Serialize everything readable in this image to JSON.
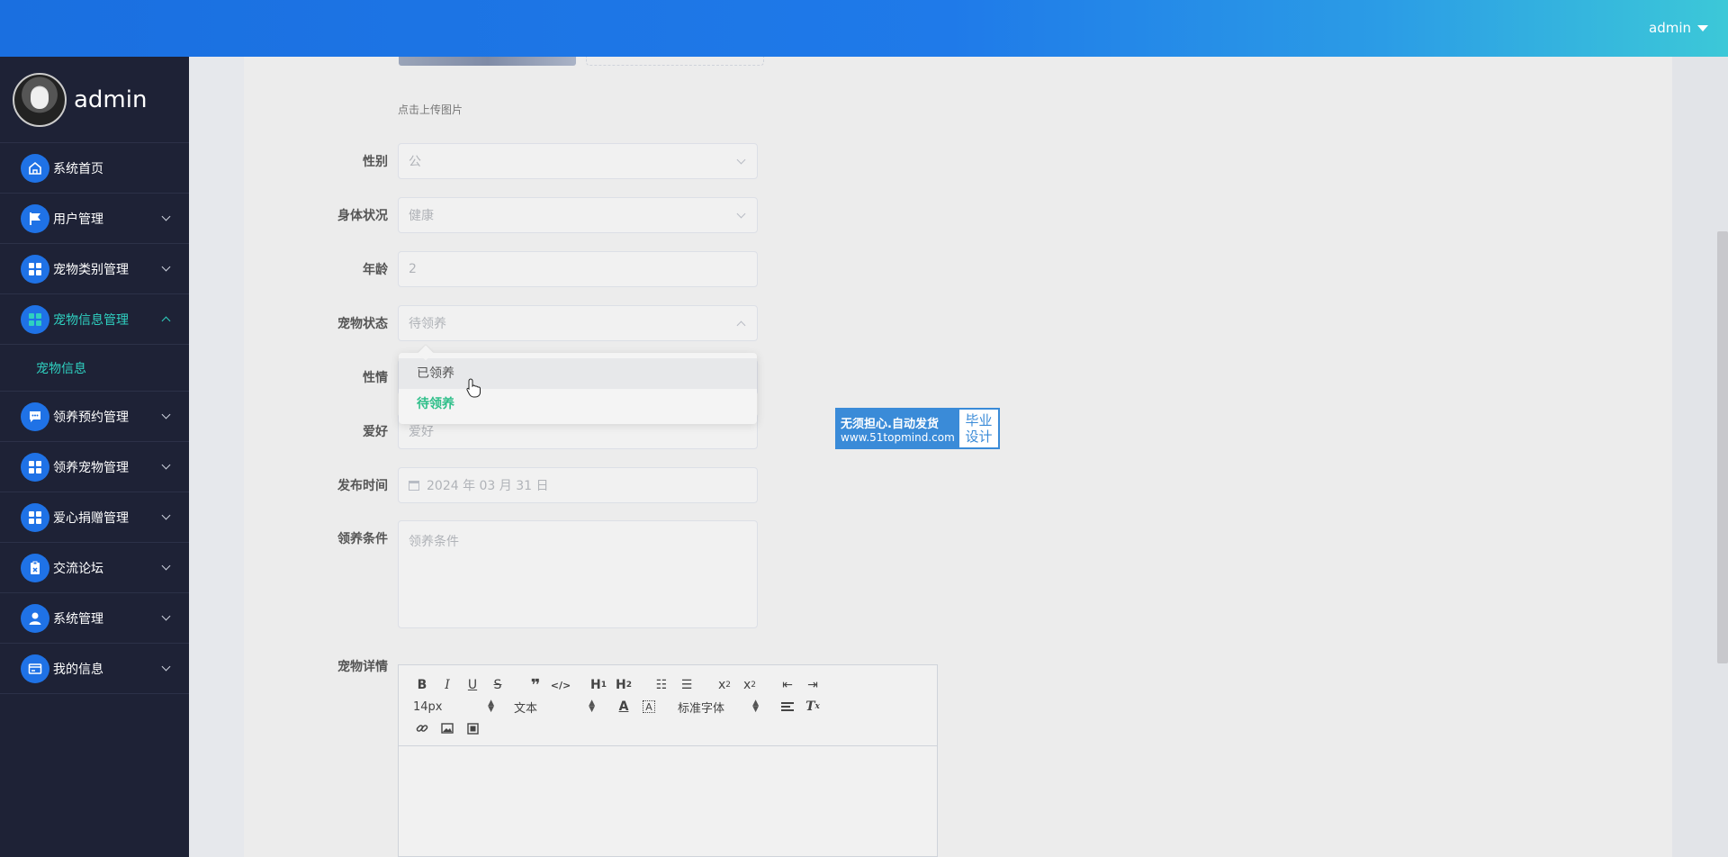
{
  "topbar": {
    "user": "admin"
  },
  "sidebar": {
    "profile_name": "admin",
    "items": [
      {
        "label": "系统首页",
        "icon": "home-icon"
      },
      {
        "label": "用户管理",
        "icon": "flag-icon"
      },
      {
        "label": "宠物类别管理",
        "icon": "grid-icon"
      },
      {
        "label": "宠物信息管理",
        "icon": "grid-icon"
      },
      {
        "label": "领养预约管理",
        "icon": "chat-icon"
      },
      {
        "label": "领养宠物管理",
        "icon": "grid-icon"
      },
      {
        "label": "爱心捐赠管理",
        "icon": "grid-icon"
      },
      {
        "label": "交流论坛",
        "icon": "clipboard-icon"
      },
      {
        "label": "系统管理",
        "icon": "user-icon"
      },
      {
        "label": "我的信息",
        "icon": "card-icon"
      }
    ],
    "submenu": {
      "label": "宠物信息"
    }
  },
  "form": {
    "upload_hint": "点击上传图片",
    "gender": {
      "label": "性别",
      "value": "公"
    },
    "health": {
      "label": "身体状况",
      "value": "健康"
    },
    "age": {
      "label": "年龄",
      "value": "2"
    },
    "status": {
      "label": "宠物状态",
      "placeholder": "待领养"
    },
    "temper": {
      "label": "性情"
    },
    "hobby": {
      "label": "爱好",
      "placeholder": "爱好"
    },
    "publish_time": {
      "label": "发布时间",
      "value": "2024 年 03 月 31 日"
    },
    "conditions": {
      "label": "领养条件",
      "placeholder": "领养条件"
    },
    "details": {
      "label": "宠物详情"
    }
  },
  "dropdown": {
    "options": [
      {
        "label": "已领养"
      },
      {
        "label": "待领养"
      }
    ]
  },
  "watermark": {
    "line1": "无须担心.自动发货",
    "line2": "www.51topmind.com",
    "right1": "毕业",
    "right2": "设计"
  },
  "editor": {
    "font_size": "14px",
    "paragraph": "文本",
    "font_family": "标准字体"
  }
}
